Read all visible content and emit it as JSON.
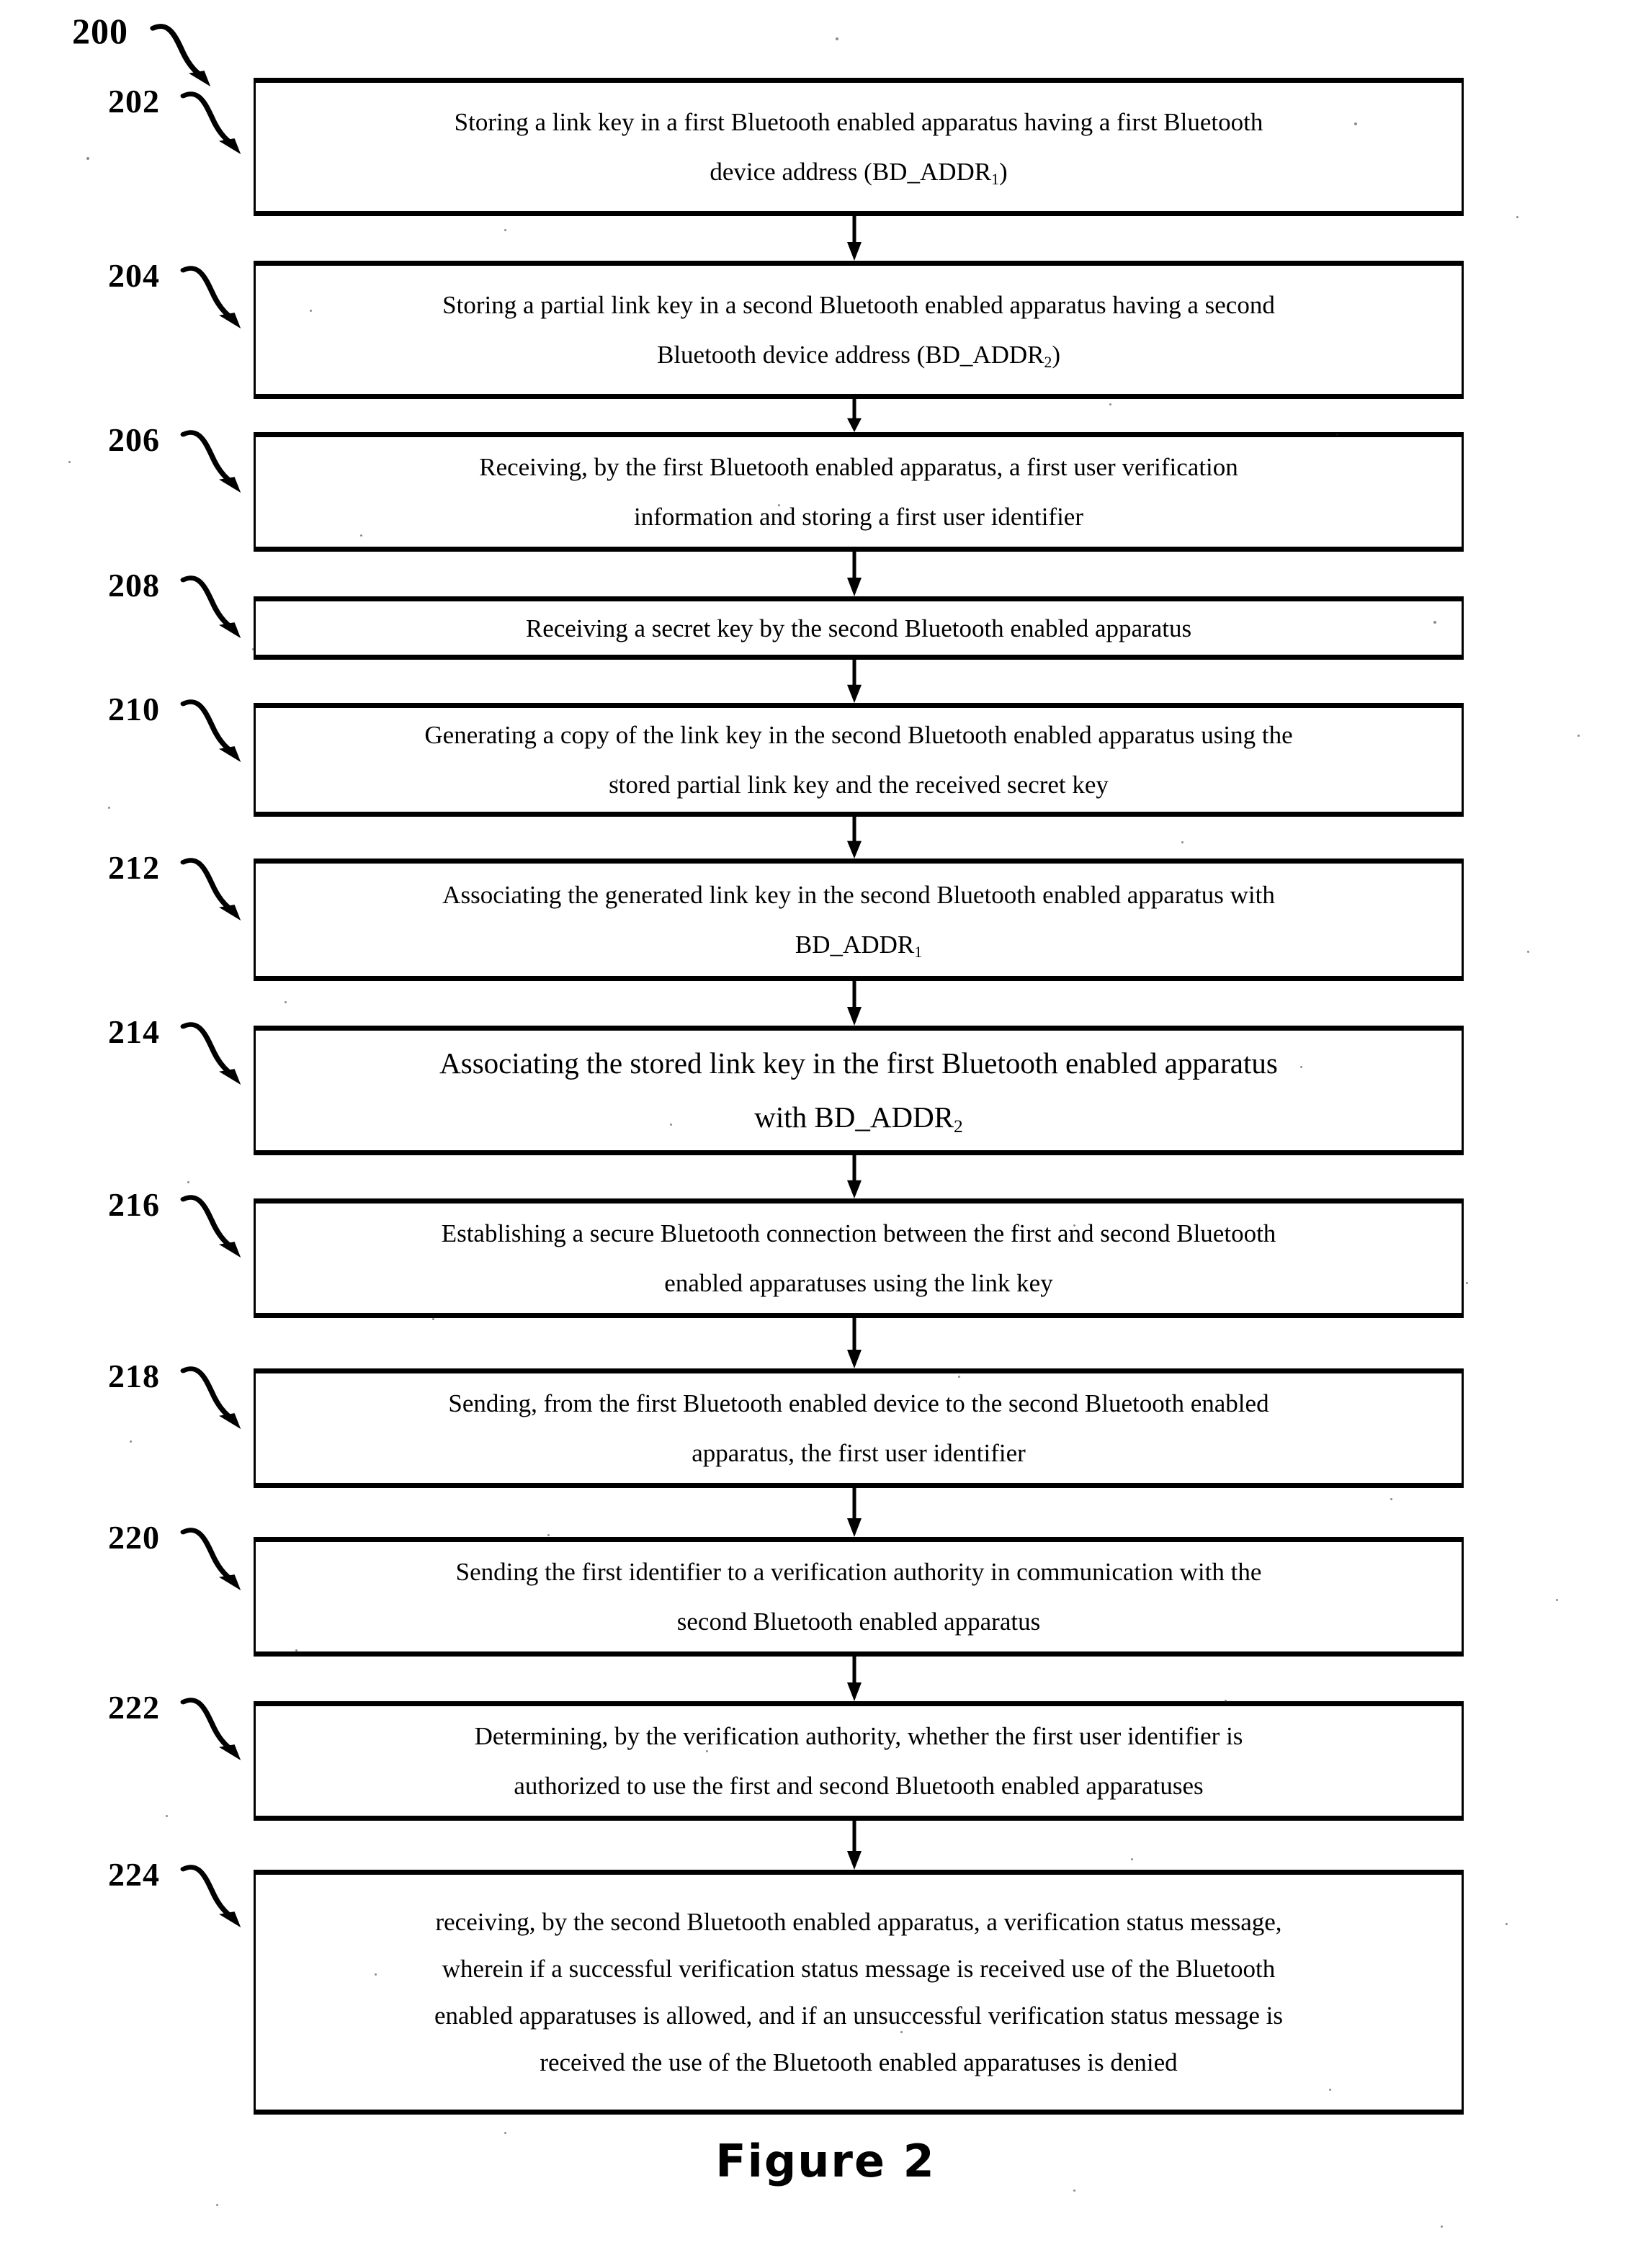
{
  "figure": {
    "caption": "Figure 2",
    "overall_ref": "200"
  },
  "flowchart": {
    "type": "patent-process-flowchart",
    "orientation": "vertical",
    "connector": "down-arrow",
    "steps": [
      {
        "ref": "202",
        "lines": [
          "Storing a link key in a first Bluetooth enabled apparatus having a first Bluetooth",
          "device address (BD_ADDR₁)"
        ]
      },
      {
        "ref": "204",
        "lines": [
          "Storing a partial link key in a second Bluetooth enabled apparatus having a second",
          "Bluetooth device address (BD_ADDR₂)"
        ]
      },
      {
        "ref": "206",
        "lines": [
          "Receiving, by the first Bluetooth enabled apparatus, a first user verification",
          "information and storing a first user identifier"
        ]
      },
      {
        "ref": "208",
        "lines": [
          "Receiving a secret key by the second Bluetooth enabled apparatus"
        ]
      },
      {
        "ref": "210",
        "lines": [
          "Generating a copy of the link key in the second Bluetooth enabled apparatus using the",
          "stored partial link key and the received secret key"
        ]
      },
      {
        "ref": "212",
        "lines": [
          "Associating the generated link key in the second Bluetooth enabled apparatus with",
          "BD_ADDR₁"
        ]
      },
      {
        "ref": "214",
        "lines": [
          "Associating the stored link key in the first Bluetooth enabled apparatus",
          "with BD_ADDR₂"
        ]
      },
      {
        "ref": "216",
        "lines": [
          "Establishing a secure Bluetooth connection between the first and second Bluetooth",
          "enabled apparatuses using the link key"
        ]
      },
      {
        "ref": "218",
        "lines": [
          "Sending, from the first Bluetooth enabled device to the second Bluetooth enabled",
          "apparatus, the first user identifier"
        ]
      },
      {
        "ref": "220",
        "lines": [
          "Sending the first identifier to a verification authority in communication with the",
          "second Bluetooth enabled apparatus"
        ]
      },
      {
        "ref": "222",
        "lines": [
          "Determining, by the verification authority, whether the first user identifier is",
          "authorized to use the first and second Bluetooth enabled apparatuses"
        ]
      },
      {
        "ref": "224",
        "lines": [
          "receiving, by the second Bluetooth enabled apparatus, a verification status message,",
          "wherein if a successful verification status message is received use of the Bluetooth",
          "enabled apparatuses is allowed, and if an unsuccessful verification status message is",
          "received the use of the Bluetooth enabled apparatuses is denied"
        ]
      }
    ]
  },
  "colors": {
    "ink": "#000000",
    "paper": "#ffffff"
  }
}
